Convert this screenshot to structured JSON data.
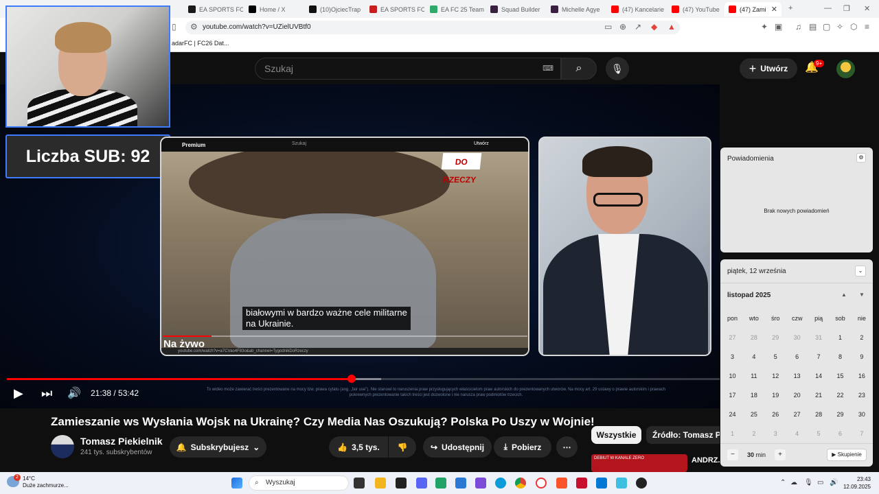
{
  "browser": {
    "tabs": [
      {
        "label": "EA SPORTS FC",
        "color": "#1a1a1a"
      },
      {
        "label": "Home / X",
        "color": "#000000"
      },
      {
        "label": "(10)OjciecTrap",
        "color": "#111111"
      },
      {
        "label": "EA SPORTS FC",
        "color": "#c81e1e"
      },
      {
        "label": "EA FC 25 Team",
        "color": "#2fa86b"
      },
      {
        "label": "Squad Builder",
        "color": "#3a2040"
      },
      {
        "label": "Michelle Agye",
        "color": "#3a2040"
      },
      {
        "label": "(47) Kancelarie",
        "color": "#ff0000"
      },
      {
        "label": "(47) YouTube",
        "color": "#ff0000"
      },
      {
        "label": "(47) Zami",
        "color": "#ff0000"
      }
    ],
    "url": "youtube.com/watch?v=UZielUVBtf0",
    "bookmark": "adarFC | FC26 Dat..."
  },
  "youtube": {
    "search_placeholder": "Szukaj",
    "create_label": "Utwórz",
    "notif_badge": "9+"
  },
  "overlay": {
    "sub_count": "Liczba SUB: 92"
  },
  "inner_video": {
    "premium": "Premium",
    "search": "Szukaj",
    "create": "Utwórz",
    "brand": "DO RZECZY",
    "caption_line1": "białowymi w bardzo ważne cele militarne",
    "caption_line2": "na Ukrainie.",
    "live": "Na żywo",
    "url": "youtube.com/watch?v=a7CVao4F83o&ab_channel=TygodnikDoRzeczy"
  },
  "player": {
    "time": "21:38 / 53:42",
    "progress": 0.484,
    "buffered": 0.525,
    "disclaimer": "To wideo może zawierać treści prezentowane na mocy tzw. prawa cytatu (ang. „fair use”). Nie stanowi to naruszenia praw przysługujących właścicielom praw autorskich do prezentowanych utworów. Na mocy art. 29 ustawy o prawie autorskim i prawach pokrewnych prezentowanie takich treści jest dozwolone i nie narusza praw podmiotów trzecich."
  },
  "video": {
    "title": "Zamieszanie ws Wysłania Wojsk na Ukrainę? Czy Media Nas Oszukują? Polska Po Uszy w Wojnie!",
    "channel": "Tomasz Piekielnik",
    "subs": "241 tys. subskrybentów",
    "subscribe": "Subskrybujesz",
    "likes": "3,5 tys.",
    "share": "Udostępnij",
    "download": "Pobierz",
    "more": "⋯"
  },
  "chips": {
    "all": "Wszystkie",
    "source": "Źródło: Tomasz Piekielnik"
  },
  "recommendation": {
    "thumb_text": "DEBIUT W KANALE ZERO",
    "title": "ANDRZ... POSYŁSKIE DRONY, NATO, CZ"
  },
  "notifications": {
    "title": "Powiadomienia",
    "empty": "Brak nowych powiadomień"
  },
  "calendar": {
    "header": "piątek, 12 września",
    "month": "listopad 2025",
    "weekdays": [
      "pon",
      "wto",
      "śro",
      "czw",
      "pią",
      "sob",
      "nie"
    ],
    "weeks": [
      [
        "27",
        "28",
        "29",
        "30",
        "31",
        "1",
        "2"
      ],
      [
        "3",
        "4",
        "5",
        "6",
        "7",
        "8",
        "9"
      ],
      [
        "10",
        "11",
        "12",
        "13",
        "14",
        "15",
        "16"
      ],
      [
        "17",
        "18",
        "19",
        "20",
        "21",
        "22",
        "23"
      ],
      [
        "24",
        "25",
        "26",
        "27",
        "28",
        "29",
        "30"
      ],
      [
        "1",
        "2",
        "3",
        "4",
        "5",
        "6",
        "7"
      ]
    ],
    "focus_value": "30",
    "focus_unit": "min",
    "focus_button": "Skupienie"
  },
  "taskbar": {
    "temp": "14°C",
    "weather": "Duże zachmurze...",
    "weather_badge": "2",
    "search": "Wyszukaj",
    "time": "23:43",
    "date": "12.09.2025"
  }
}
